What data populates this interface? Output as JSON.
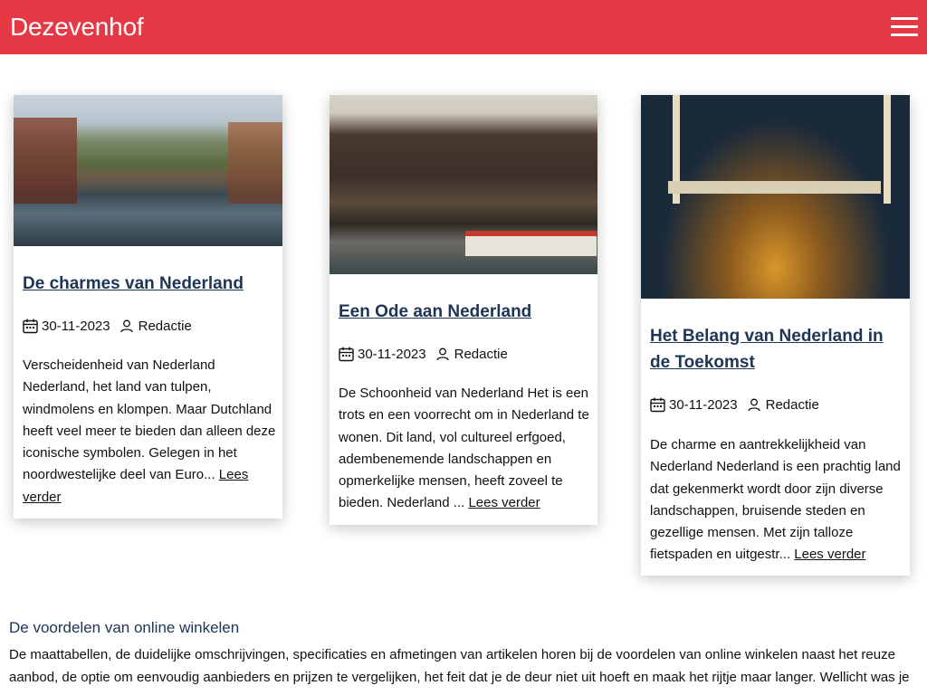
{
  "header": {
    "brand": "Dezevenhof",
    "menu_icon": "hamburger-menu-icon",
    "background_color": "#e63946"
  },
  "cards": [
    {
      "title": "De charmes van Nederland",
      "date": "30-11-2023",
      "author": "Redactie",
      "excerpt": "Verscheidenheid van Nederland Nederland, het land van tulpen, windmolens en klompen. Maar Dutchland heeft veel meer te bieden dan alleen deze iconische symbolen. Gelegen in het noordwestelijke deel van Euro...",
      "read_more": "Lees verder"
    },
    {
      "title": "Een Ode aan Nederland",
      "date": "30-11-2023",
      "author": "Redactie",
      "excerpt": "De Schoonheid van Nederland Het is een trots en een voorrecht om in Nederland te wonen. Dit land, vol cultureel erfgoed, adembenemende landschappen en opmerkelijke mensen, heeft zoveel te bieden. Nederland ...",
      "read_more": "Lees verder"
    },
    {
      "title": "Het Belang van Nederland in de Toekomst",
      "date": "30-11-2023",
      "author": "Redactie",
      "excerpt": "De charme en aantrekkelijkheid van Nederland Nederland is een prachtig land dat gekenmerkt wordt door zijn diverse landschappen, bruisende steden en gezellige mensen. Met zijn talloze fietspaden en uitgestr...",
      "read_more": "Lees verder"
    }
  ],
  "section": {
    "title": "De voordelen van online winkelen",
    "text": "De maattabellen, de duidelijke omschrijvingen, specificaties en afmetingen van artikelen horen bij de voordelen van online winkelen naast het reuze aanbod, de optie om eenvoudig aanbieders en prijzen te vergelijken, het feit dat je de deur niet uit hoeft en maak het rijtje maar langer. Wellicht was je"
  },
  "colors": {
    "title_link": "#1d3557",
    "text": "#111111"
  }
}
